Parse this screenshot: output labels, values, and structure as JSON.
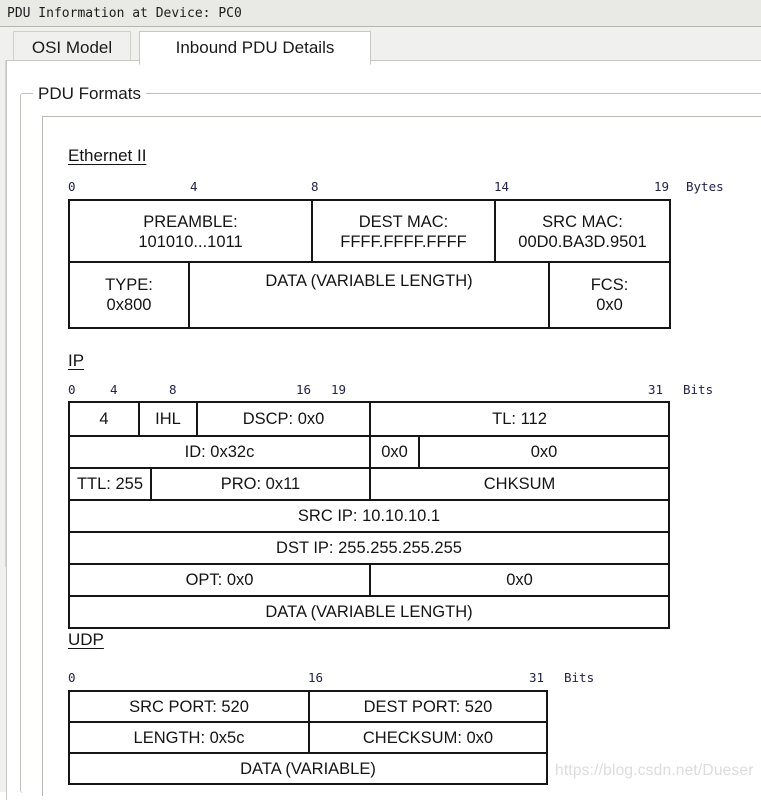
{
  "window": {
    "title": "PDU Information at Device: PC0"
  },
  "tabs": [
    {
      "label": "OSI Model",
      "active": false
    },
    {
      "label": "Inbound PDU Details",
      "active": true
    }
  ],
  "groupbox": {
    "label": "PDU Formats"
  },
  "sections": {
    "ethernet": {
      "title": "Ethernet II",
      "ruler": {
        "ticks": [
          "0",
          "4",
          "8",
          "14",
          "19"
        ],
        "unit": "Bytes"
      },
      "row1": [
        {
          "label": "PREAMBLE:",
          "value": "101010...1011"
        },
        {
          "label": "DEST MAC:",
          "value": "FFFF.FFFF.FFFF"
        },
        {
          "label": "SRC MAC:",
          "value": "00D0.BA3D.9501"
        }
      ],
      "row2": [
        {
          "label": "TYPE:",
          "value": "0x800"
        },
        {
          "label": "DATA (VARIABLE LENGTH)",
          "value": ""
        },
        {
          "label": "FCS:",
          "value": "0x0"
        }
      ]
    },
    "ip": {
      "title": "IP",
      "ruler": {
        "ticks": [
          "0",
          "4",
          "8",
          "16",
          "19",
          "31"
        ],
        "unit": "Bits"
      },
      "rows": [
        [
          "4",
          "IHL",
          "DSCP: 0x0",
          "TL: 112"
        ],
        [
          "ID: 0x32c",
          "0x0",
          "0x0"
        ],
        [
          "TTL: 255",
          "PRO: 0x11",
          "CHKSUM"
        ],
        [
          "SRC IP: 10.10.10.1"
        ],
        [
          "DST IP: 255.255.255.255"
        ],
        [
          "OPT: 0x0",
          "0x0"
        ],
        [
          "DATA (VARIABLE LENGTH)"
        ]
      ]
    },
    "udp": {
      "title": "UDP",
      "ruler": {
        "ticks": [
          "0",
          "16",
          "31"
        ],
        "unit": "Bits"
      },
      "rows": [
        [
          "SRC PORT: 520",
          "DEST PORT: 520"
        ],
        [
          "LENGTH: 0x5c",
          "CHECKSUM: 0x0"
        ],
        [
          "DATA (VARIABLE)"
        ]
      ]
    }
  },
  "watermark": {
    "text": "https://blog.csdn.net/Dueser"
  }
}
